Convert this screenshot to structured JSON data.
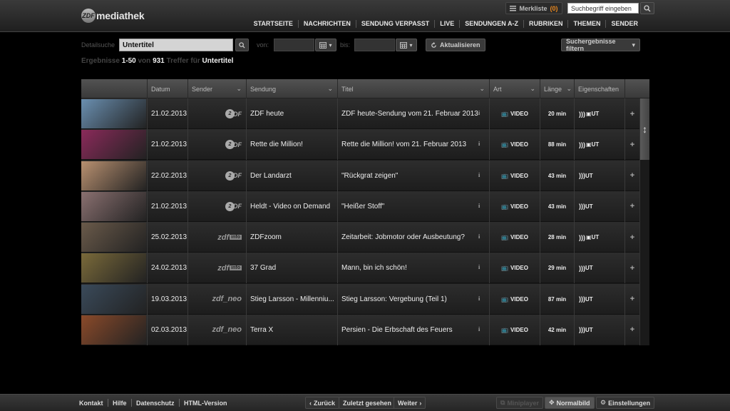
{
  "header": {
    "logo_mark": "ZDF",
    "logo_text": "mediathek",
    "merkliste_label": "Merkliste",
    "merkliste_count": "(0)",
    "search_placeholder": "Suchbegriff eingeben",
    "nav": [
      "STARTSEITE",
      "NACHRICHTEN",
      "SENDUNG VERPASST",
      "LIVE",
      "SENDUNGEN A-Z",
      "RUBRIKEN",
      "THEMEN",
      "SENDER"
    ]
  },
  "search": {
    "detail_label": "Detailsuche",
    "query": "Untertitel",
    "from_label": "von:",
    "to_label": "bis:",
    "refresh_label": "Aktualisieren",
    "filter_label": "Suchergebnisse filtern"
  },
  "results": {
    "prefix": "Ergebnisse",
    "range": "1-50",
    "of": "von",
    "total": "931",
    "hits_for": "Treffer für",
    "term": "Untertitel"
  },
  "table": {
    "columns": [
      "Datum",
      "Sender",
      "Sendung",
      "Titel",
      "Art",
      "Länge",
      "Eigenschaften"
    ],
    "rows": [
      {
        "date": "21.02.2013",
        "sender": "zdf",
        "sendung": "ZDF heute",
        "titel": "ZDF heute-Sendung vom 21. Februar 2013",
        "art": "VIDEO",
        "laenge": "20 min",
        "props": "UT",
        "hd": true,
        "thumb": "#6a8fb0"
      },
      {
        "date": "21.02.2013",
        "sender": "zdf",
        "sendung": "Rette die Million!",
        "titel": "Rette die Million! vom 21. Februar 2013",
        "art": "VIDEO",
        "laenge": "88 min",
        "props": "UT",
        "hd": true,
        "thumb": "#8a2a5a"
      },
      {
        "date": "22.02.2013",
        "sender": "zdf",
        "sendung": "Der Landarzt",
        "titel": "\"Rückgrat zeigen\"",
        "art": "VIDEO",
        "laenge": "43 min",
        "props": "UT",
        "hd": false,
        "thumb": "#b89070"
      },
      {
        "date": "21.02.2013",
        "sender": "zdf",
        "sendung": "Heldt - Video on Demand",
        "titel": "\"Heißer Stoff\"",
        "art": "VIDEO",
        "laenge": "43 min",
        "props": "UT",
        "hd": false,
        "thumb": "#8a7070"
      },
      {
        "date": "25.02.2013",
        "sender": "zdfinfo",
        "sendung": "ZDFzoom",
        "titel": "Zeitarbeit: Jobmotor oder Ausbeutung?",
        "art": "VIDEO",
        "laenge": "28 min",
        "props": "UT",
        "hd": true,
        "thumb": "#6a5a4a"
      },
      {
        "date": "24.02.2013",
        "sender": "zdfinfo",
        "sendung": "37 Grad",
        "titel": "Mann, bin ich schön!",
        "art": "VIDEO",
        "laenge": "29 min",
        "props": "UT",
        "hd": false,
        "thumb": "#7a6a3a"
      },
      {
        "date": "19.03.2013",
        "sender": "zdfneo",
        "sendung": "Stieg Larsson - Millenniu...",
        "titel": "Stieg Larsson: Vergebung (Teil 1)",
        "art": "VIDEO",
        "laenge": "87 min",
        "props": "UT",
        "hd": false,
        "thumb": "#3a4a5a"
      },
      {
        "date": "02.03.2013",
        "sender": "zdfneo",
        "sendung": "Terra X",
        "titel": "Persien - Die Erbschaft des Feuers",
        "art": "VIDEO",
        "laenge": "42 min",
        "props": "UT",
        "hd": false,
        "thumb": "#8a4a2a"
      }
    ]
  },
  "footer": {
    "links": [
      "Kontakt",
      "Hilfe",
      "Datenschutz",
      "HTML-Version"
    ],
    "back": "Zurück",
    "recent": "Zuletzt gesehen",
    "next": "Weiter",
    "miniplayer": "Miniplayer",
    "normalbild": "Normalbild",
    "settings": "Einstellungen"
  }
}
